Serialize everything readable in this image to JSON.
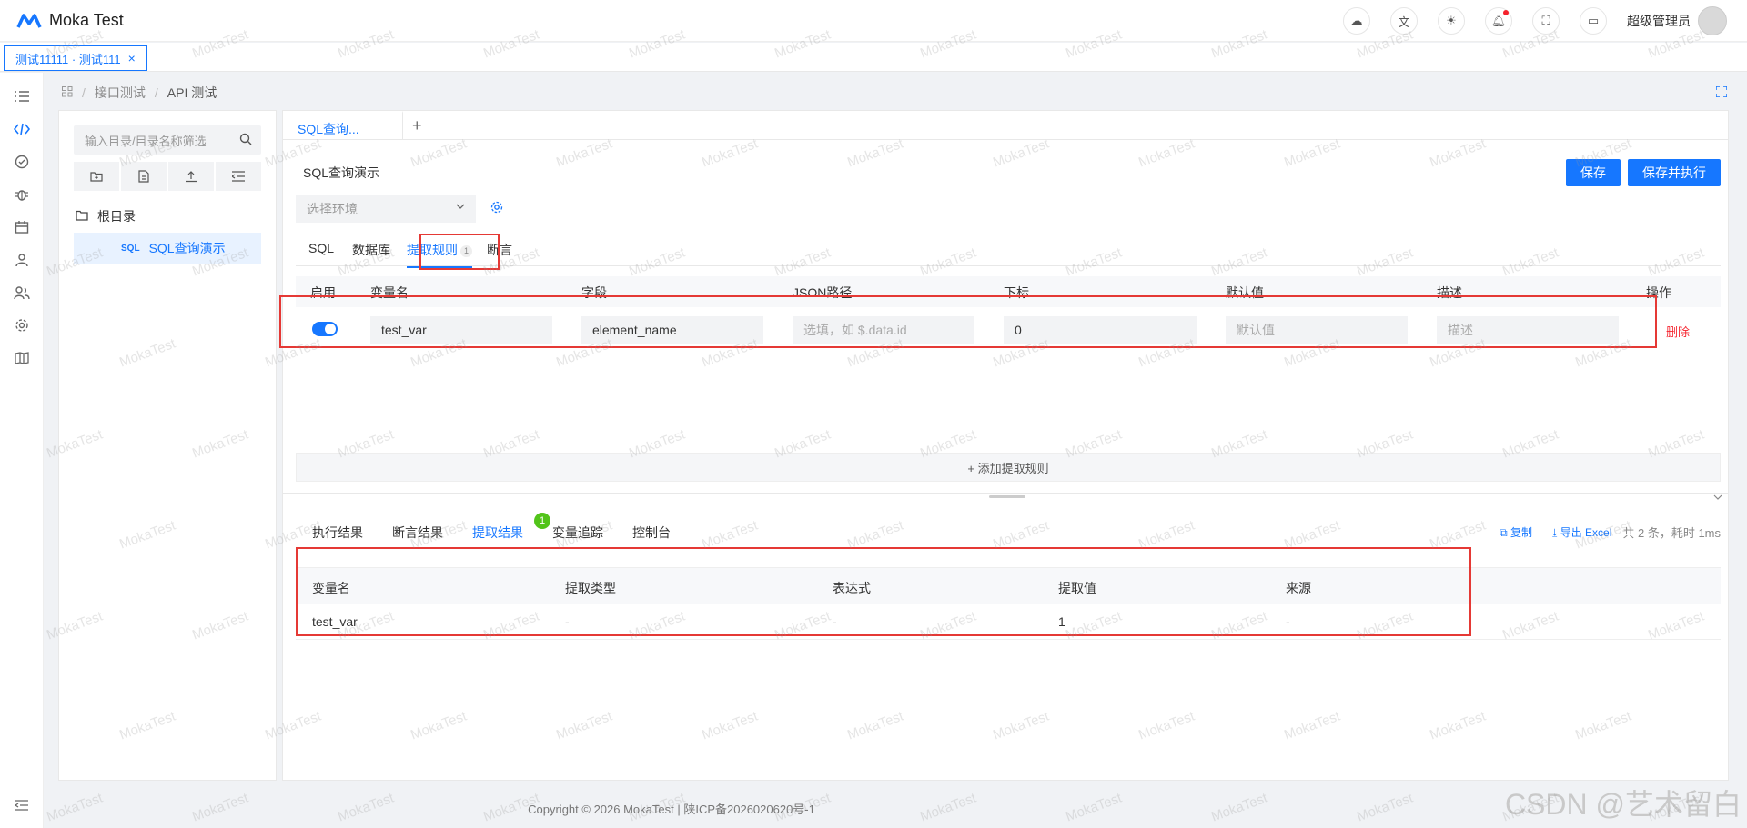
{
  "header": {
    "app_name": "Moka Test",
    "user_name": "超级管理员"
  },
  "tabstrip": {
    "page_tab_label": "测试11111 · 测试111",
    "close_glyph": "×"
  },
  "breadcrumb": {
    "items": [
      "接口测试",
      "API 测试"
    ]
  },
  "tree": {
    "search_placeholder": "输入目录/目录名称筛选",
    "root_label": "根目录",
    "node_badge": "SQL",
    "node_label": "SQL查询演示"
  },
  "request": {
    "tab_label": "SQL查询...",
    "add_tab": "+",
    "name": "SQL查询演示",
    "save_label": "保存",
    "save_run_label": "保存并执行",
    "env_placeholder": "选择环境",
    "sub_tabs": [
      "SQL",
      "数据库",
      "提取规则",
      "断言"
    ],
    "rule_count": "1"
  },
  "rules": {
    "headers": [
      "启用",
      "变量名",
      "字段",
      "JSON路径",
      "下标",
      "默认值",
      "描述",
      "操作"
    ],
    "row": {
      "enabled": true,
      "var_name": "test_var",
      "field": "element_name",
      "json_path_placeholder": "选填，如 $.data.id",
      "index": "0",
      "default_placeholder": "默认值",
      "desc_placeholder": "描述",
      "delete_label": "删除"
    },
    "add_label": "+ 添加提取规则"
  },
  "results": {
    "tabs": [
      "执行结果",
      "断言结果",
      "提取结果",
      "变量追踪",
      "控制台"
    ],
    "extract_badge": "1",
    "copy_label": "复制",
    "export_label": "导出 Excel",
    "stats": "共 2 条，耗时 1ms",
    "headers": [
      "变量名",
      "提取类型",
      "表达式",
      "提取值",
      "来源"
    ],
    "row": [
      "test_var",
      "-",
      "-",
      "1",
      "-"
    ]
  },
  "footer": {
    "copyright": "Copyright © 2026 MokaTest | 陕ICP备2026020620号-1",
    "csdn": "CSDN @艺术留白"
  },
  "watermark_text": "MokaTest",
  "colors": {
    "accent": "#1677ff",
    "danger": "#f5222d",
    "success": "#52c41a",
    "highlight": "#e53935"
  }
}
